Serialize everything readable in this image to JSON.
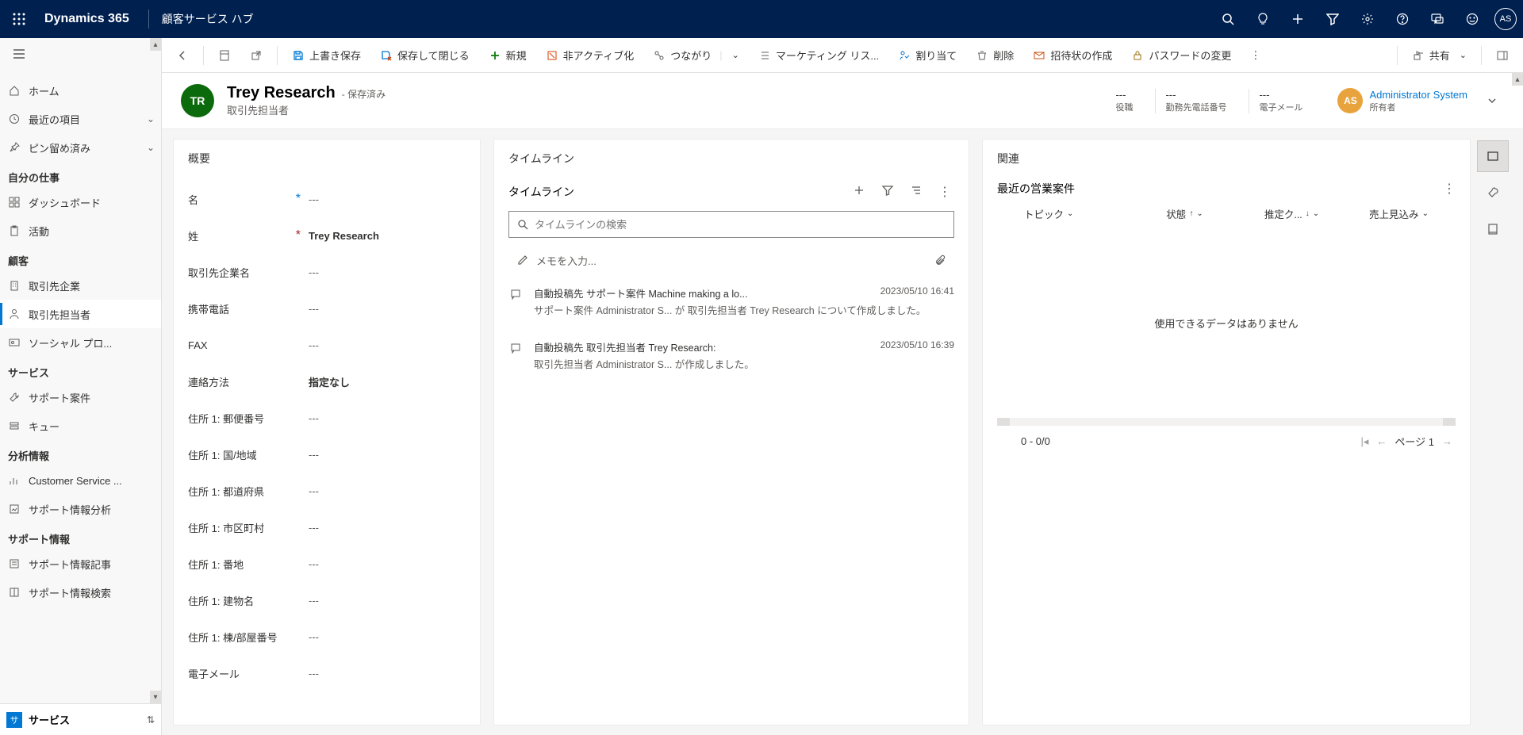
{
  "topnav": {
    "brand": "Dynamics 365",
    "app": "顧客サービス ハブ",
    "avatar": "AS"
  },
  "sidebar": {
    "home": "ホーム",
    "recent": "最近の項目",
    "pinned": "ピン留め済み",
    "section_mywork": "自分の仕事",
    "dashboards": "ダッシュボード",
    "activities": "活動",
    "section_customers": "顧客",
    "accounts": "取引先企業",
    "contacts": "取引先担当者",
    "social": "ソーシャル プロ...",
    "section_service": "サービス",
    "cases": "サポート案件",
    "queues": "キュー",
    "section_insights": "分析情報",
    "cs_insights": "Customer Service ...",
    "case_insights": "サポート情報分析",
    "section_knowledge": "サポート情報",
    "kb_articles": "サポート情報記事",
    "kb_search": "サポート情報検索",
    "footer_label": "サービス",
    "footer_badge": "サ"
  },
  "cmdbar": {
    "save": "上書き保存",
    "save_close": "保存して閉じる",
    "new": "新規",
    "deactivate": "非アクティブ化",
    "connect": "つながり",
    "marketing": "マーケティング リス...",
    "assign": "割り当て",
    "delete": "削除",
    "invite": "招待状の作成",
    "password": "パスワードの変更",
    "share": "共有"
  },
  "header": {
    "avatar": "TR",
    "title": "Trey Research",
    "status": "- 保存済み",
    "subtitle": "取引先担当者",
    "jobtitle_val": "---",
    "jobtitle_label": "役職",
    "phone_val": "---",
    "phone_label": "勤務先電話番号",
    "email_val": "---",
    "email_label": "電子メール",
    "owner_avatar": "AS",
    "owner_name": "Administrator System",
    "owner_label": "所有者"
  },
  "summary": {
    "title": "概要",
    "fields": {
      "firstname_l": "名",
      "firstname_v": "---",
      "lastname_l": "姓",
      "lastname_v": "Trey Research",
      "company_l": "取引先企業名",
      "company_v": "---",
      "mobile_l": "携帯電話",
      "mobile_v": "---",
      "fax_l": "FAX",
      "fax_v": "---",
      "pref_l": "連絡方法",
      "pref_v": "指定なし",
      "zip_l": "住所 1: 郵便番号",
      "zip_v": "---",
      "country_l": "住所 1: 国/地域",
      "country_v": "---",
      "state_l": "住所 1: 都道府県",
      "state_v": "---",
      "city_l": "住所 1: 市区町村",
      "city_v": "---",
      "street1_l": "住所 1: 番地",
      "street1_v": "---",
      "street2_l": "住所 1: 建物名",
      "street2_v": "---",
      "street3_l": "住所 1: 棟/部屋番号",
      "street3_v": "---",
      "email_l": "電子メール",
      "email_v": "---"
    }
  },
  "timeline": {
    "outer_title": "タイムライン",
    "title": "タイムライン",
    "search_ph": "タイムラインの検索",
    "note_ph": "メモを入力...",
    "items": [
      {
        "title": "自動投稿先 サポート案件 Machine making a lo...",
        "time": "2023/05/10 16:41",
        "desc": "サポート案件 Administrator S...  が 取引先担当者  Trey Research について作成しました。"
      },
      {
        "title": "自動投稿先 取引先担当者 Trey Research:",
        "time": "2023/05/10 16:39",
        "desc": "取引先担当者 Administrator S...  が作成しました。"
      }
    ]
  },
  "related": {
    "outer_title": "関連",
    "title": "最近の営業案件",
    "cols": {
      "topic": "トピック",
      "status": "状態",
      "estclose": "推定ク...",
      "estrev": "売上見込み"
    },
    "empty": "使用できるデータはありません",
    "count": "0 - 0/0",
    "page": "ページ 1"
  }
}
